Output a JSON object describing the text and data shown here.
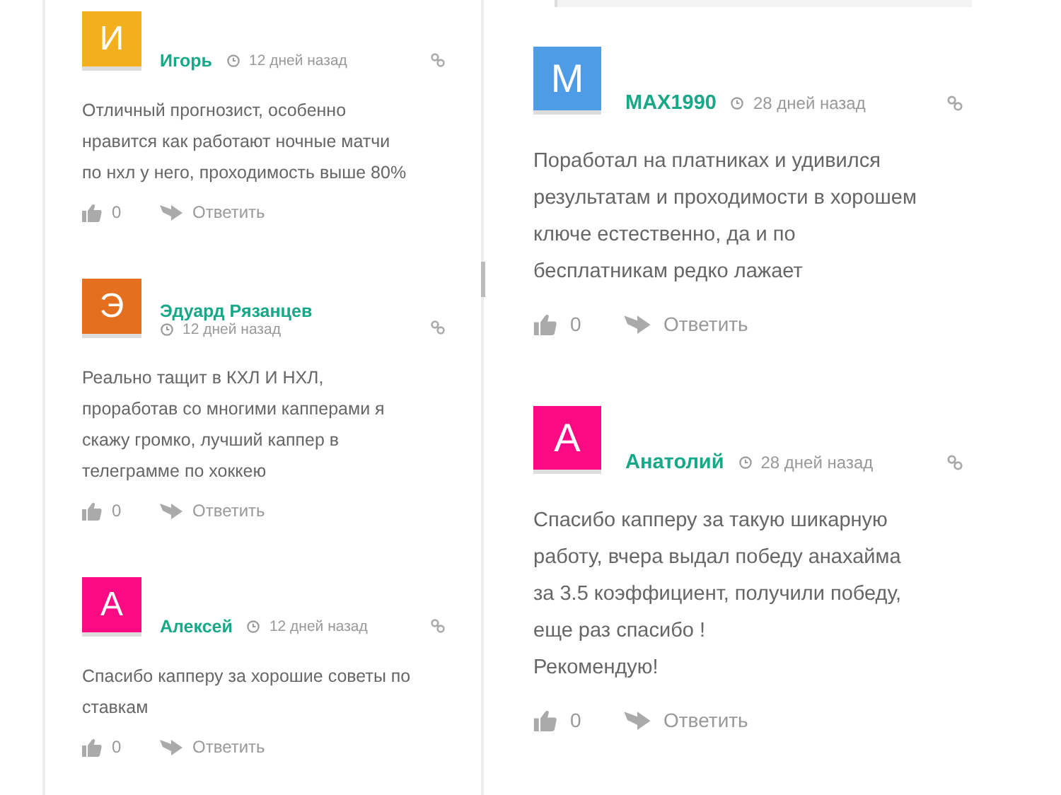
{
  "left_column": {
    "comments": [
      {
        "initial": "И",
        "color": "#f2b01e",
        "name": "Игорь",
        "time": "12 дней назад",
        "text": "Отличный прогнозист, особенно\nнравится как работают ночные матчи\nпо нхл у него, проходимость выше 80%",
        "likes": "0",
        "reply": "Ответить"
      },
      {
        "initial": "Э",
        "color": "#e46f1e",
        "name": "Эдуард Рязанцев",
        "time": "12 дней назад",
        "text": "Реально тащит в КХЛ И НХЛ,\nпроработав со многими капперами я\nскажу громко, лучший каппер в\nтелеграмме по хоккею",
        "likes": "0",
        "reply": "Ответить"
      },
      {
        "initial": "А",
        "color": "#fc0a84",
        "name": "Алексей",
        "time": "12 дней назад",
        "text": "Спасибо капперу за хорошие советы по\nставкам",
        "likes": "0",
        "reply": "Ответить"
      }
    ]
  },
  "right_column": {
    "comments": [
      {
        "initial": "M",
        "color": "#4e9be6",
        "name": "MAX1990",
        "time": "28 дней назад",
        "text": "Поработал на платниках и удивился\nрезультатам и проходимости в хорошем\nключе естественно, да и по\nбесплатникам редко лажает",
        "likes": "0",
        "reply": "Ответить"
      },
      {
        "initial": "А",
        "color": "#fc0a84",
        "name": "Анатолий",
        "time": "28 дней назад",
        "text": "Спасибо капперу за такую шикарную\nработу, вчера выдал победу анахайма\nза 3.5 коэффициент, получили победу,\nеще раз спасибо !\nРекомендую!",
        "likes": "0",
        "reply": "Ответить"
      }
    ]
  }
}
